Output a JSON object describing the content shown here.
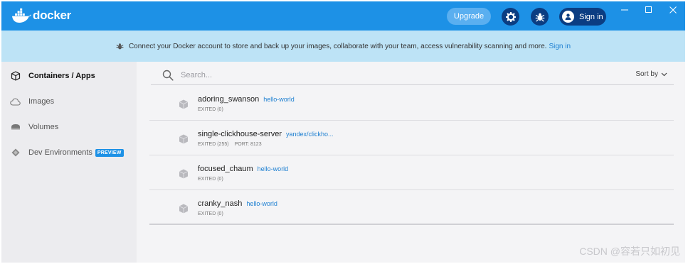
{
  "app": {
    "logo_text": "docker"
  },
  "titlebar": {
    "upgrade_label": "Upgrade",
    "signin_label": "Sign in",
    "icons": [
      "gear-icon",
      "bug-icon",
      "user-icon"
    ],
    "window_controls": [
      "minimize",
      "maximize",
      "close"
    ]
  },
  "banner": {
    "text": "Connect your Docker account to store and back up your images, collaborate with your team, access vulnerability scanning and more.",
    "link": "Sign in"
  },
  "sidebar": {
    "items": [
      {
        "label": "Containers / Apps",
        "icon": "container-icon",
        "active": true
      },
      {
        "label": "Images",
        "icon": "cloud-icon",
        "active": false
      },
      {
        "label": "Volumes",
        "icon": "volume-icon",
        "active": false
      },
      {
        "label": "Dev Environments",
        "icon": "dev-environments-icon",
        "active": false,
        "badge": "PREVIEW"
      }
    ]
  },
  "search": {
    "placeholder": "Search..."
  },
  "sort": {
    "label": "Sort by"
  },
  "containers": [
    {
      "name": "adoring_swanson",
      "image": "hello-world",
      "status": "EXITED (0)",
      "port": ""
    },
    {
      "name": "single-clickhouse-server",
      "image": "yandex/clickho...",
      "status": "EXITED (255)",
      "port": "PORT: 8123"
    },
    {
      "name": "focused_chaum",
      "image": "hello-world",
      "status": "EXITED (0)",
      "port": ""
    },
    {
      "name": "cranky_nash",
      "image": "hello-world",
      "status": "EXITED (0)",
      "port": ""
    }
  ],
  "watermark": "CSDN @容若只如初见",
  "colors": {
    "titlebar": "#1d91e6",
    "banner": "#bde3f6",
    "accent_dark": "#0b3d82",
    "link": "#1d7fd1"
  }
}
